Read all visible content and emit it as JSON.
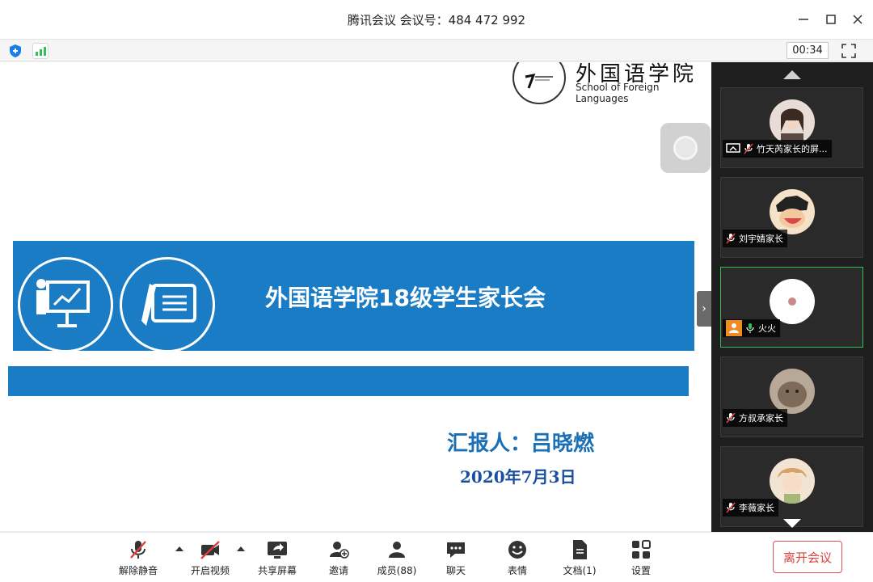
{
  "window": {
    "title": "腾讯会议 会议号：484 472 992"
  },
  "status": {
    "timer": "00:34"
  },
  "slide": {
    "logo_cn": "外国语学院",
    "logo_en": "School of Foreign Languages",
    "title": "外国语学院18级学生家长会",
    "reporter": "汇报人：吕晓燃",
    "date": "2020年7月3日"
  },
  "participants": [
    {
      "name": "竹天芮家长的屏...",
      "muted": true,
      "sharing": true,
      "host": false,
      "active": false
    },
    {
      "name": "刘宇婧家长",
      "muted": true,
      "sharing": false,
      "host": false,
      "active": false
    },
    {
      "name": "火火",
      "muted": false,
      "sharing": false,
      "host": true,
      "active": true
    },
    {
      "name": "方叔承家长",
      "muted": true,
      "sharing": false,
      "host": false,
      "active": false
    },
    {
      "name": "李薇家长",
      "muted": true,
      "sharing": false,
      "host": false,
      "active": false
    }
  ],
  "toolbar": {
    "unmute": "解除静音",
    "video": "开启视频",
    "share": "共享屏幕",
    "invite": "邀请",
    "members": "成员(88)",
    "chat": "聊天",
    "emoji": "表情",
    "docs": "文档(1)",
    "settings": "设置",
    "leave": "离开会议"
  },
  "colors": {
    "slide_blue": "#1b7cc6",
    "leave_red": "#e03e3e",
    "active_green": "#2fbf5b",
    "panel_bg": "#1e1e1e"
  }
}
